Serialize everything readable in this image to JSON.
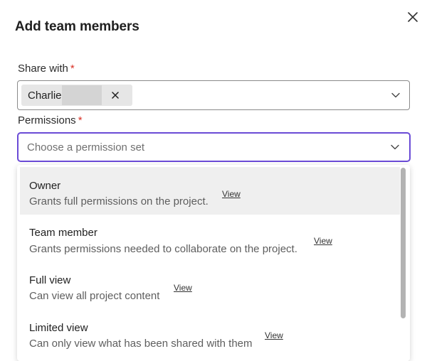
{
  "dialog": {
    "title": "Add team members"
  },
  "share_with": {
    "label": "Share with",
    "required_mark": "*",
    "chip_name": "Charlie"
  },
  "permissions": {
    "label": "Permissions",
    "required_mark": "*",
    "placeholder": "Choose a permission set",
    "options": [
      {
        "title": "Owner",
        "description": "Grants full permissions on the project.",
        "view": "View"
      },
      {
        "title": "Team member",
        "description": "Grants permissions needed to collaborate on the project.",
        "view": "View"
      },
      {
        "title": "Full view",
        "description": "Can view all project content",
        "view": "View"
      },
      {
        "title": "Limited view",
        "description": "Can only view what has been shared with them",
        "view": "View"
      }
    ]
  },
  "colors": {
    "focus_border": "#6a4bd6",
    "required": "#d93025",
    "hover_bg": "#efefef"
  },
  "icons": {
    "close": "close-icon",
    "chip_remove": "close-icon",
    "dropdown": "chevron-down-icon"
  }
}
